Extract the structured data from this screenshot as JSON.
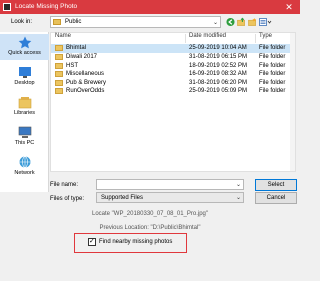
{
  "window": {
    "title": "Locate Missing Photo",
    "close_glyph": "✕"
  },
  "lookin": {
    "label": "Look in:",
    "value": "Public",
    "chevron": "⌄"
  },
  "places": [
    {
      "label": "Quick access",
      "icon": "star-icon"
    },
    {
      "label": "Desktop",
      "icon": "desktop-icon"
    },
    {
      "label": "Libraries",
      "icon": "libraries-icon"
    },
    {
      "label": "This PC",
      "icon": "computer-icon"
    },
    {
      "label": "Network",
      "icon": "network-icon"
    }
  ],
  "filelist": {
    "columns": [
      "Name",
      "Date modified",
      "Type"
    ],
    "rows": [
      {
        "name": "Bhimtal",
        "date": "25-09-2019 10:04 AM",
        "type": "File folder",
        "selected": true
      },
      {
        "name": "Diwali 2017",
        "date": "31-08-2019 06:15 PM",
        "type": "File folder",
        "selected": false
      },
      {
        "name": "HST",
        "date": "18-09-2019 02:52 PM",
        "type": "File folder",
        "selected": false
      },
      {
        "name": "Miscellaneous",
        "date": "16-09-2019 08:32 AM",
        "type": "File folder",
        "selected": false
      },
      {
        "name": "Pub & Brewery",
        "date": "31-08-2019 06:20 PM",
        "type": "File folder",
        "selected": false
      },
      {
        "name": "RunOverOdds",
        "date": "25-09-2019 05:09 PM",
        "type": "File folder",
        "selected": false
      }
    ]
  },
  "filename": {
    "label": "File name:",
    "value": ""
  },
  "filetype": {
    "label": "Files of type:",
    "value": "Supported Files"
  },
  "buttons": {
    "select": "Select",
    "cancel": "Cancel"
  },
  "info": {
    "locate": "Locate \"WP_20180330_07_08_01_Pro.jpg\"",
    "previous": "Previous Location: \"D:\\Public\\Bhimtal\""
  },
  "option": {
    "label": "Find nearby missing photos",
    "checked": true,
    "check_glyph": "✓"
  },
  "colors": {
    "titlebar": "#d93a40",
    "selection": "#cce4f7",
    "highlight_border": "#e0383d"
  }
}
